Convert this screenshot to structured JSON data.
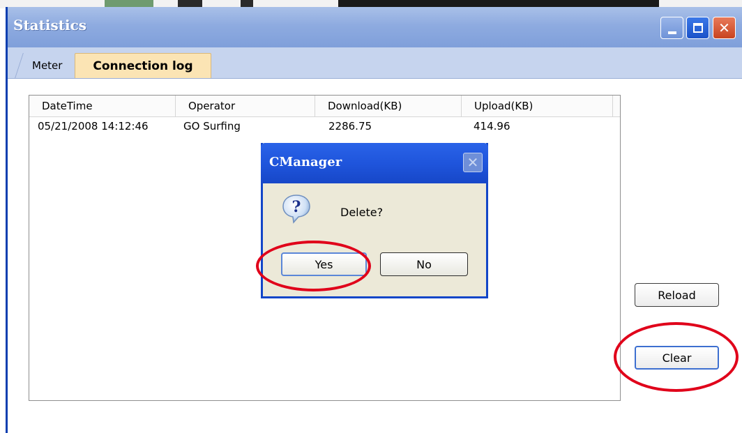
{
  "window": {
    "title": "Statistics"
  },
  "tabs": [
    {
      "label": "Meter",
      "active": false
    },
    {
      "label": "Connection log",
      "active": true
    }
  ],
  "table": {
    "columns": [
      "DateTime",
      "Operator",
      "Download(KB)",
      "Upload(KB)"
    ],
    "rows": [
      [
        "05/21/2008 14:12:46",
        "GO Surfing",
        "2286.75",
        "414.96"
      ]
    ]
  },
  "buttons": {
    "reload": "Reload",
    "clear": "Clear"
  },
  "dialog": {
    "title": "CManager",
    "message": "Delete?",
    "yes": "Yes",
    "no": "No",
    "icon": "question-icon"
  },
  "colors": {
    "titlebar": "#8eabe0",
    "active_tab": "#fbe4b4",
    "dialog_titlebar": "#1f55dc",
    "annotation": "#e0001a"
  }
}
